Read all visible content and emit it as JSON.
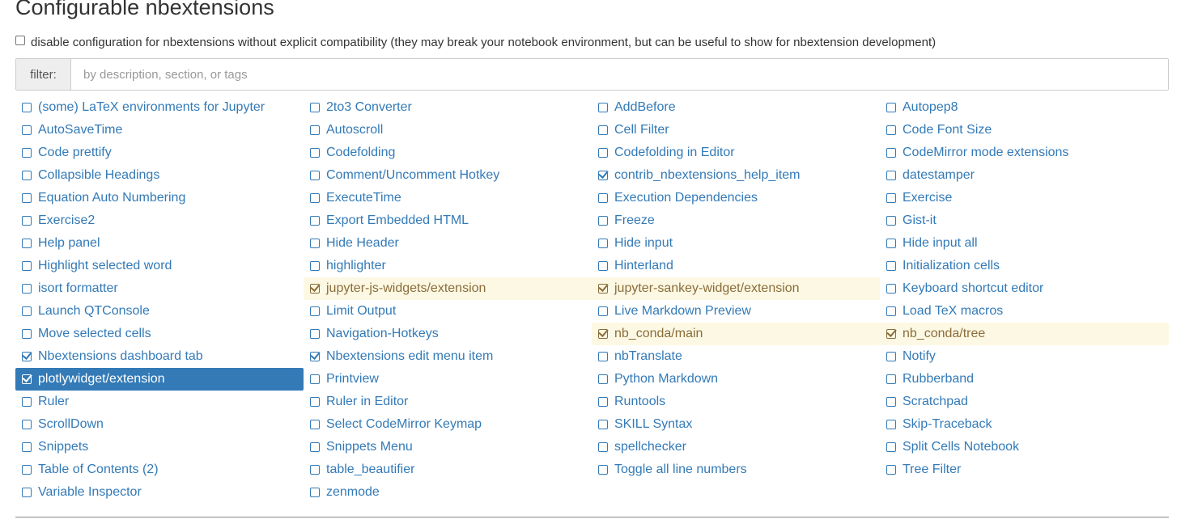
{
  "title": "Configurable nbextensions",
  "compat_label": "disable configuration for nbextensions without explicit compatibility (they may break your notebook environment, but can be useful to show for nbextension development)",
  "filter": {
    "label": "filter:",
    "placeholder": "by description, section, or tags"
  },
  "colors": {
    "link": "#337ab7",
    "enabled_bg": "#fcf8e3",
    "enabled_text": "#8a6d3b",
    "selected_bg": "#337ab7"
  },
  "extensions": [
    {
      "label": "(some) LaTeX environments for Jupyter",
      "checked": false
    },
    {
      "label": "2to3 Converter",
      "checked": false
    },
    {
      "label": "AddBefore",
      "checked": false
    },
    {
      "label": "Autopep8",
      "checked": false
    },
    {
      "label": "AutoSaveTime",
      "checked": false
    },
    {
      "label": "Autoscroll",
      "checked": false
    },
    {
      "label": "Cell Filter",
      "checked": false
    },
    {
      "label": "Code Font Size",
      "checked": false
    },
    {
      "label": "Code prettify",
      "checked": false
    },
    {
      "label": "Codefolding",
      "checked": false
    },
    {
      "label": "Codefolding in Editor",
      "checked": false
    },
    {
      "label": "CodeMirror mode extensions",
      "checked": false
    },
    {
      "label": "Collapsible Headings",
      "checked": false
    },
    {
      "label": "Comment/Uncomment Hotkey",
      "checked": false
    },
    {
      "label": "contrib_nbextensions_help_item",
      "checked": true
    },
    {
      "label": "datestamper",
      "checked": false
    },
    {
      "label": "Equation Auto Numbering",
      "checked": false
    },
    {
      "label": "ExecuteTime",
      "checked": false
    },
    {
      "label": "Execution Dependencies",
      "checked": false
    },
    {
      "label": "Exercise",
      "checked": false
    },
    {
      "label": "Exercise2",
      "checked": false
    },
    {
      "label": "Export Embedded HTML",
      "checked": false
    },
    {
      "label": "Freeze",
      "checked": false
    },
    {
      "label": "Gist-it",
      "checked": false
    },
    {
      "label": "Help panel",
      "checked": false
    },
    {
      "label": "Hide Header",
      "checked": false
    },
    {
      "label": "Hide input",
      "checked": false
    },
    {
      "label": "Hide input all",
      "checked": false
    },
    {
      "label": "Highlight selected word",
      "checked": false
    },
    {
      "label": "highlighter",
      "checked": false
    },
    {
      "label": "Hinterland",
      "checked": false
    },
    {
      "label": "Initialization cells",
      "checked": false
    },
    {
      "label": "isort formatter",
      "checked": false
    },
    {
      "label": "jupyter-js-widgets/extension",
      "checked": true,
      "state": "enabled"
    },
    {
      "label": "jupyter-sankey-widget/extension",
      "checked": true,
      "state": "enabled"
    },
    {
      "label": "Keyboard shortcut editor",
      "checked": false
    },
    {
      "label": "Launch QTConsole",
      "checked": false
    },
    {
      "label": "Limit Output",
      "checked": false
    },
    {
      "label": "Live Markdown Preview",
      "checked": false
    },
    {
      "label": "Load TeX macros",
      "checked": false
    },
    {
      "label": "Move selected cells",
      "checked": false
    },
    {
      "label": "Navigation-Hotkeys",
      "checked": false
    },
    {
      "label": "nb_conda/main",
      "checked": true,
      "state": "enabled"
    },
    {
      "label": "nb_conda/tree",
      "checked": true,
      "state": "enabled"
    },
    {
      "label": "Nbextensions dashboard tab",
      "checked": true
    },
    {
      "label": "Nbextensions edit menu item",
      "checked": true
    },
    {
      "label": "nbTranslate",
      "checked": false
    },
    {
      "label": "Notify",
      "checked": false
    },
    {
      "label": "plotlywidget/extension",
      "checked": true,
      "state": "selected"
    },
    {
      "label": "Printview",
      "checked": false
    },
    {
      "label": "Python Markdown",
      "checked": false
    },
    {
      "label": "Rubberband",
      "checked": false
    },
    {
      "label": "Ruler",
      "checked": false
    },
    {
      "label": "Ruler in Editor",
      "checked": false
    },
    {
      "label": "Runtools",
      "checked": false
    },
    {
      "label": "Scratchpad",
      "checked": false
    },
    {
      "label": "ScrollDown",
      "checked": false
    },
    {
      "label": "Select CodeMirror Keymap",
      "checked": false
    },
    {
      "label": "SKILL Syntax",
      "checked": false
    },
    {
      "label": "Skip-Traceback",
      "checked": false
    },
    {
      "label": "Snippets",
      "checked": false
    },
    {
      "label": "Snippets Menu",
      "checked": false
    },
    {
      "label": "spellchecker",
      "checked": false
    },
    {
      "label": "Split Cells Notebook",
      "checked": false
    },
    {
      "label": "Table of Contents (2)",
      "checked": false
    },
    {
      "label": "table_beautifier",
      "checked": false
    },
    {
      "label": "Toggle all line numbers",
      "checked": false
    },
    {
      "label": "Tree Filter",
      "checked": false
    },
    {
      "label": "Variable Inspector",
      "checked": false
    },
    {
      "label": "zenmode",
      "checked": false
    }
  ]
}
